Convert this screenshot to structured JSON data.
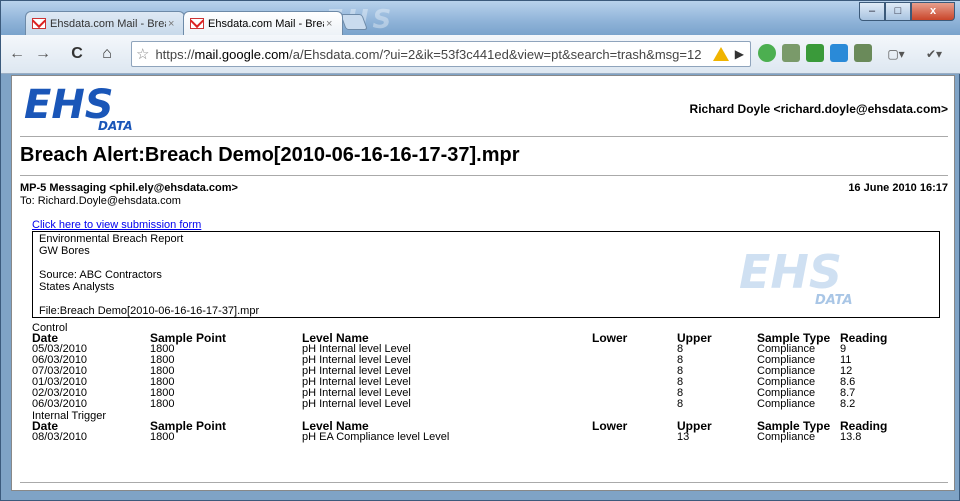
{
  "browser": {
    "tabs": [
      {
        "label": "Ehsdata.com Mail - Breac...",
        "close": "×"
      },
      {
        "label": "Ehsdata.com Mail - Breac...",
        "close": "×"
      }
    ],
    "window_buttons": {
      "minimize": "–",
      "maximize": "□",
      "close": "x"
    },
    "nav": {
      "back": "←",
      "forward": "→",
      "reload": "C",
      "home": "⌂"
    },
    "url_scheme": "https://",
    "url_host": "mail.google.com",
    "url_rest": "/a/Ehsdata.com/?ui=2&ik=53f3c441ed&view=pt&search=trash&msg=12",
    "star": "☆",
    "play": "▶",
    "page_menu": "▢▾",
    "wrench": "✔▾"
  },
  "email": {
    "recipient_header": "Richard Doyle <richard.doyle@ehsdata.com>",
    "subject": "Breach Alert:Breach Demo[2010-06-16-16-17-37].mpr",
    "from": "MP-5 Messaging <phil.ely@ehsdata.com>",
    "to": "To: Richard.Doyle@ehsdata.com",
    "date": "16 June 2010 16:17",
    "link_text": "Click here to view submission form",
    "report": {
      "title": "Environmental Breach Report",
      "subtitle": "GW Bores",
      "source": "Source: ABC Contractors",
      "analysts": "States Analysts",
      "file": "File:Breach Demo[2010-06-16-16-17-37].mpr"
    },
    "logo_text": "EHS",
    "logo_sub": "DATA"
  },
  "headers": {
    "date": "Date",
    "sample_point": "Sample Point",
    "level_name": "Level Name",
    "lower": "Lower",
    "upper": "Upper",
    "sample_type": "Sample Type",
    "reading": "Reading"
  },
  "sections": [
    {
      "name": "Control",
      "rows": [
        [
          "05/03/2010",
          "1800",
          "pH Internal level Level",
          "",
          "8",
          "Compliance",
          "9"
        ],
        [
          "06/03/2010",
          "1800",
          "pH Internal level Level",
          "",
          "8",
          "Compliance",
          "11"
        ],
        [
          "07/03/2010",
          "1800",
          "pH Internal level Level",
          "",
          "8",
          "Compliance",
          "12"
        ],
        [
          "01/03/2010",
          "1800",
          "pH Internal level Level",
          "",
          "8",
          "Compliance",
          "8.6"
        ],
        [
          "02/03/2010",
          "1800",
          "pH Internal level Level",
          "",
          "8",
          "Compliance",
          "8.7"
        ],
        [
          "06/03/2010",
          "1800",
          "pH Internal level Level",
          "",
          "8",
          "Compliance",
          "8.2"
        ]
      ]
    },
    {
      "name": "Internal Trigger",
      "rows": [
        [
          "08/03/2010",
          "1800",
          "pH EA Compliance level Level",
          "",
          "13",
          "Compliance",
          "13.8"
        ]
      ]
    }
  ]
}
